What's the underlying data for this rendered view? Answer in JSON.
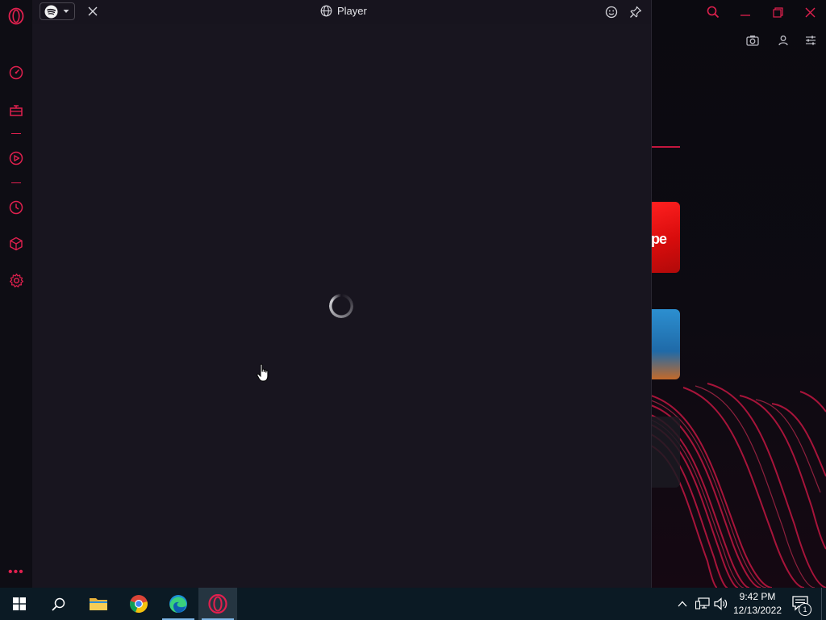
{
  "player": {
    "title": "Player",
    "service": "spotify-icon",
    "state": "loading"
  },
  "sidebar": {
    "items": [
      {
        "icon": "opera-logo-icon"
      },
      {
        "icon": "speed-dial-icon"
      },
      {
        "icon": "gift-icon"
      },
      {
        "icon": "player-icon"
      },
      {
        "icon": "history-icon"
      },
      {
        "icon": "extensions-icon"
      },
      {
        "icon": "settings-icon"
      },
      {
        "icon": "more-icon"
      }
    ]
  },
  "taskbar": {
    "apps": [
      {
        "icon": "windows-start-icon"
      },
      {
        "icon": "search-icon"
      },
      {
        "icon": "file-explorer-icon"
      },
      {
        "icon": "chrome-icon"
      },
      {
        "icon": "edge-icon"
      },
      {
        "icon": "opera-icon"
      }
    ],
    "time": "9:42 PM",
    "date": "12/13/2022",
    "notification_count": "1"
  },
  "browser": {
    "tile_text": "pe"
  },
  "colors": {
    "accent": "#e0204e",
    "panel_bg": "#18151f",
    "taskbar_bg": "#0b1a24"
  }
}
